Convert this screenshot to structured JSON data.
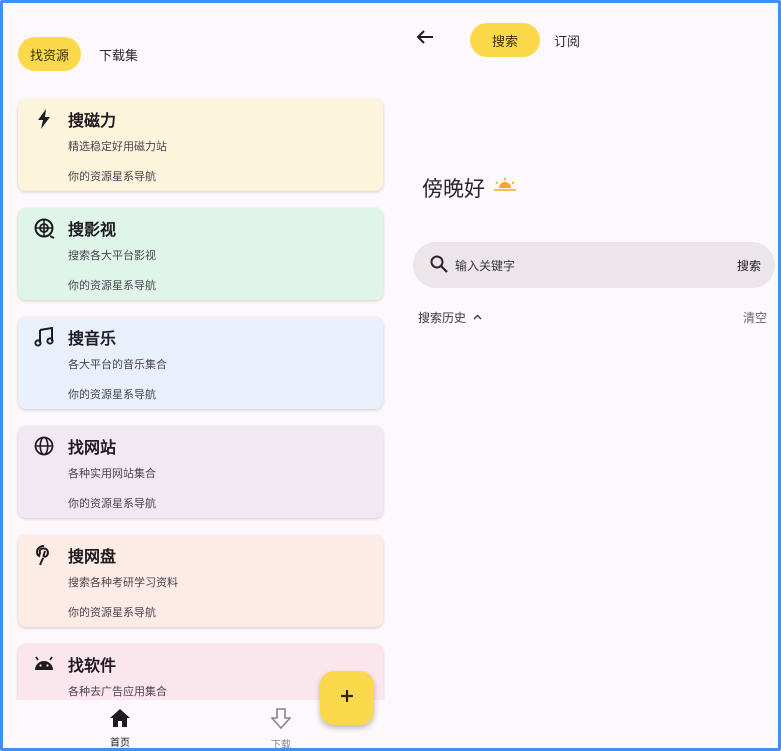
{
  "left": {
    "tabs": [
      {
        "label": "找资源",
        "active": true
      },
      {
        "label": "下载集",
        "active": false
      }
    ],
    "cards": [
      {
        "icon": "lightning-icon",
        "title": "搜磁力",
        "desc": "精选稳定好用磁力站",
        "sub": "你的资源星系导航",
        "color": "#fdf4dc"
      },
      {
        "icon": "film-reel-icon",
        "title": "搜影视",
        "desc": "搜索各大平台影视",
        "sub": "你的资源星系导航",
        "color": "#dff5ea"
      },
      {
        "icon": "music-note-icon",
        "title": "搜音乐",
        "desc": "各大平台的音乐集合",
        "sub": "你的资源星系导航",
        "color": "#eaf0fb"
      },
      {
        "icon": "globe-icon",
        "title": "找网站",
        "desc": "各种实用网站集合",
        "sub": "你的资源星系导航",
        "color": "#f1e8f3"
      },
      {
        "icon": "pinterest-icon",
        "title": "搜网盘",
        "desc": "搜索各种考研学习资料",
        "sub": "你的资源星系导航",
        "color": "#fdece6"
      },
      {
        "icon": "android-icon",
        "title": "找软件",
        "desc": "各种去广告应用集合",
        "sub": "",
        "color": "#fce6ee"
      }
    ],
    "nav": [
      {
        "icon": "home-icon",
        "label": "首页"
      },
      {
        "icon": "download-icon",
        "label": "下载"
      }
    ],
    "fab_icon": "plus-icon"
  },
  "right": {
    "tabs": [
      {
        "label": "搜索",
        "active": true
      },
      {
        "label": "订阅",
        "active": false
      }
    ],
    "greeting": "傍晚好",
    "search_placeholder": "输入关键字",
    "search_button": "搜索",
    "history_label": "搜索历史",
    "clear_label": "清空"
  },
  "colors": {
    "accent": "#fcd94b",
    "frame": "#3f8ff5",
    "background": "#fdf8fb"
  }
}
